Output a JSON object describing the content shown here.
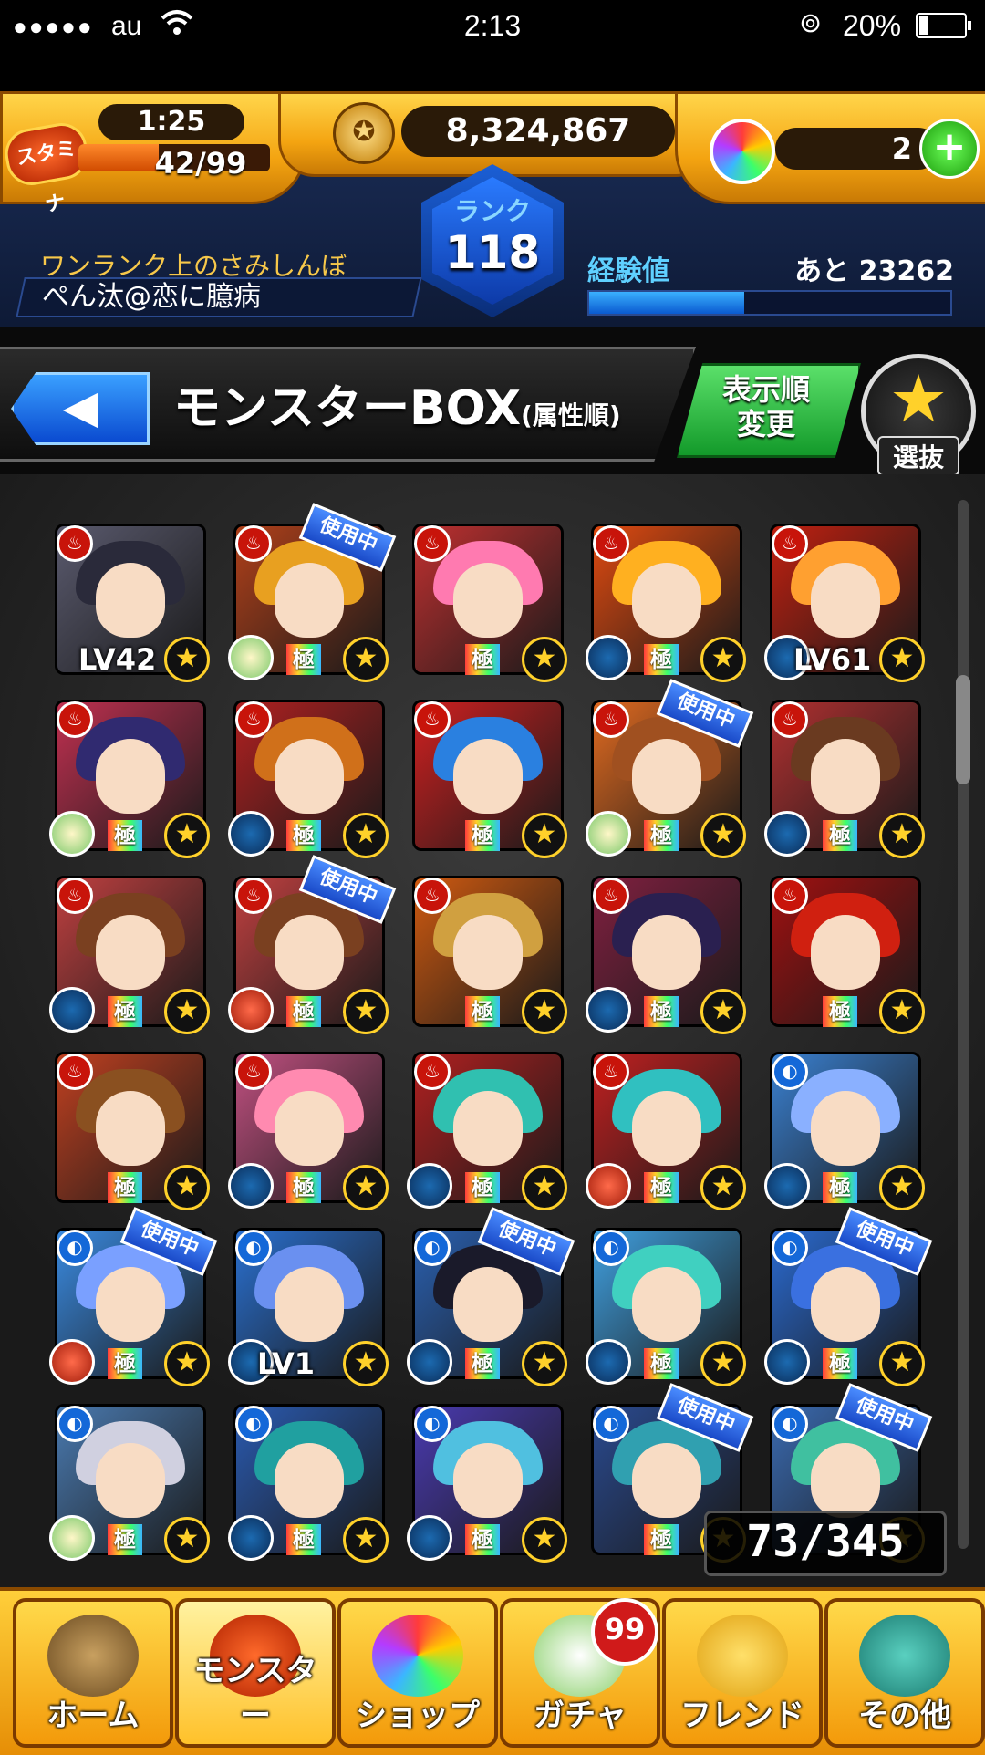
{
  "status_bar": {
    "signal": "●●●●●",
    "carrier": "au",
    "time": "2:13",
    "battery": "20%",
    "battery_level": 0.2
  },
  "header": {
    "stamina_label": "スタミナ",
    "stamina_timer": "1:25",
    "stamina": "42/99",
    "stamina_fraction": 0.42,
    "coins": "8,324,867",
    "orbs": "2",
    "rank_label": "ランク",
    "rank": "118",
    "title": "ワンランク上のさみしんぼ",
    "player_name": "ぺん汰@恋に臆病",
    "exp_label": "経験値",
    "exp_remaining": "あと 23262",
    "exp_fraction": 0.43
  },
  "title_bar": {
    "title": "モンスターBOX",
    "subtitle": "(属性順)",
    "sort_line1": "表示順",
    "sort_line2": "変更",
    "select_label": "選抜"
  },
  "colors": {
    "fire": "#c8140a",
    "water": "#1468d8",
    "gold": "#ffd12a"
  },
  "monsters": [
    {
      "elem": "fire",
      "badge": "none",
      "rank": "",
      "inuse": false,
      "lv": "LV42",
      "bg": "#5a5a6e",
      "hair": "#2a2a3a"
    },
    {
      "elem": "fire",
      "badge": "lotus",
      "rank": "極",
      "inuse": true,
      "lv": "",
      "bg": "#b0401a",
      "hair": "#e8a020"
    },
    {
      "elem": "fire",
      "badge": "none",
      "rank": "極",
      "inuse": false,
      "lv": "",
      "bg": "#c03030",
      "hair": "#ff7ab0"
    },
    {
      "elem": "fire",
      "badge": "water",
      "rank": "極",
      "inuse": false,
      "lv": "",
      "bg": "#e04a10",
      "hair": "#ffb020"
    },
    {
      "elem": "fire",
      "badge": "water",
      "rank": "",
      "inuse": false,
      "lv": "LV61",
      "bg": "#c02010",
      "hair": "#ffa030"
    },
    {
      "elem": "fire",
      "badge": "lotus",
      "rank": "極",
      "inuse": false,
      "lv": "",
      "bg": "#c03050",
      "hair": "#302a70"
    },
    {
      "elem": "fire",
      "badge": "water",
      "rank": "極",
      "inuse": false,
      "lv": "",
      "bg": "#b02020",
      "hair": "#d0701a"
    },
    {
      "elem": "fire",
      "badge": "none",
      "rank": "極",
      "inuse": false,
      "lv": "",
      "bg": "#d02020",
      "hair": "#2a80e0"
    },
    {
      "elem": "fire",
      "badge": "lotus",
      "rank": "極",
      "inuse": true,
      "lv": "",
      "bg": "#e06a20",
      "hair": "#a05020"
    },
    {
      "elem": "fire",
      "badge": "water",
      "rank": "極",
      "inuse": false,
      "lv": "",
      "bg": "#b03030",
      "hair": "#6a3a20"
    },
    {
      "elem": "fire",
      "badge": "water",
      "rank": "極",
      "inuse": false,
      "lv": "",
      "bg": "#c04040",
      "hair": "#7a4020"
    },
    {
      "elem": "fire",
      "badge": "apple",
      "rank": "極",
      "inuse": true,
      "lv": "",
      "bg": "#c04040",
      "hair": "#7a4020"
    },
    {
      "elem": "fire",
      "badge": "none",
      "rank": "極",
      "inuse": false,
      "lv": "",
      "bg": "#d05a10",
      "hair": "#d0a040"
    },
    {
      "elem": "fire",
      "badge": "water",
      "rank": "極",
      "inuse": false,
      "lv": "",
      "bg": "#802040",
      "hair": "#2a2050"
    },
    {
      "elem": "fire",
      "badge": "none",
      "rank": "極",
      "inuse": false,
      "lv": "",
      "bg": "#a01010",
      "hair": "#d02010"
    },
    {
      "elem": "fire",
      "badge": "none",
      "rank": "極",
      "inuse": false,
      "lv": "",
      "bg": "#c04020",
      "hair": "#8a5020"
    },
    {
      "elem": "fire",
      "badge": "water",
      "rank": "極",
      "inuse": false,
      "lv": "",
      "bg": "#c05080",
      "hair": "#ff8ab0"
    },
    {
      "elem": "fire",
      "badge": "water",
      "rank": "極",
      "inuse": false,
      "lv": "",
      "bg": "#b02020",
      "hair": "#30c0b0"
    },
    {
      "elem": "fire",
      "badge": "apple",
      "rank": "極",
      "inuse": false,
      "lv": "",
      "bg": "#c02020",
      "hair": "#30c0c0"
    },
    {
      "elem": "water",
      "badge": "water",
      "rank": "極",
      "inuse": false,
      "lv": "",
      "bg": "#3a80d0",
      "hair": "#8ab0ff"
    },
    {
      "elem": "water",
      "badge": "apple",
      "rank": "極",
      "inuse": true,
      "lv": "",
      "bg": "#3a8ae0",
      "hair": "#7aa0ff"
    },
    {
      "elem": "water",
      "badge": "water",
      "rank": "",
      "inuse": false,
      "lv": "LV1",
      "bg": "#2a70d0",
      "hair": "#6a90f0"
    },
    {
      "elem": "water",
      "badge": "water",
      "rank": "極",
      "inuse": true,
      "lv": "",
      "bg": "#2a60b0",
      "hair": "#1a1a2a"
    },
    {
      "elem": "water",
      "badge": "water",
      "rank": "極",
      "inuse": false,
      "lv": "",
      "bg": "#40a0e0",
      "hair": "#40d0c0"
    },
    {
      "elem": "water",
      "badge": "water",
      "rank": "極",
      "inuse": true,
      "lv": "",
      "bg": "#2a6ad0",
      "hair": "#3a70e0"
    },
    {
      "elem": "water",
      "badge": "lotus",
      "rank": "極",
      "inuse": false,
      "lv": "",
      "bg": "#4a7ab0",
      "hair": "#d0d0e0"
    },
    {
      "elem": "water",
      "badge": "water",
      "rank": "極",
      "inuse": false,
      "lv": "",
      "bg": "#2a5ab0",
      "hair": "#20a0a0"
    },
    {
      "elem": "water",
      "badge": "water",
      "rank": "極",
      "inuse": false,
      "lv": "",
      "bg": "#4a3ab0",
      "hair": "#50c0e0"
    },
    {
      "elem": "water",
      "badge": "none",
      "rank": "極",
      "inuse": true,
      "lv": "",
      "bg": "#2a4a90",
      "hair": "#30a0b0"
    },
    {
      "elem": "water",
      "badge": "none",
      "rank": "",
      "inuse": true,
      "lv": "",
      "bg": "#3a6ab0",
      "hair": "#40c0a0"
    }
  ],
  "inuse_label": "使用中",
  "box_count": "73/345",
  "bottom_nav": [
    {
      "label": "ホーム",
      "icon": "home-icon"
    },
    {
      "label": "モンスター",
      "icon": "monster-icon"
    },
    {
      "label": "ショップ",
      "icon": "orb-icon"
    },
    {
      "label": "ガチャ",
      "icon": "egg-icon"
    },
    {
      "label": "フレンド",
      "icon": "friend-icon"
    },
    {
      "label": "その他",
      "icon": "other-icon"
    }
  ],
  "gacha_badge": "99"
}
